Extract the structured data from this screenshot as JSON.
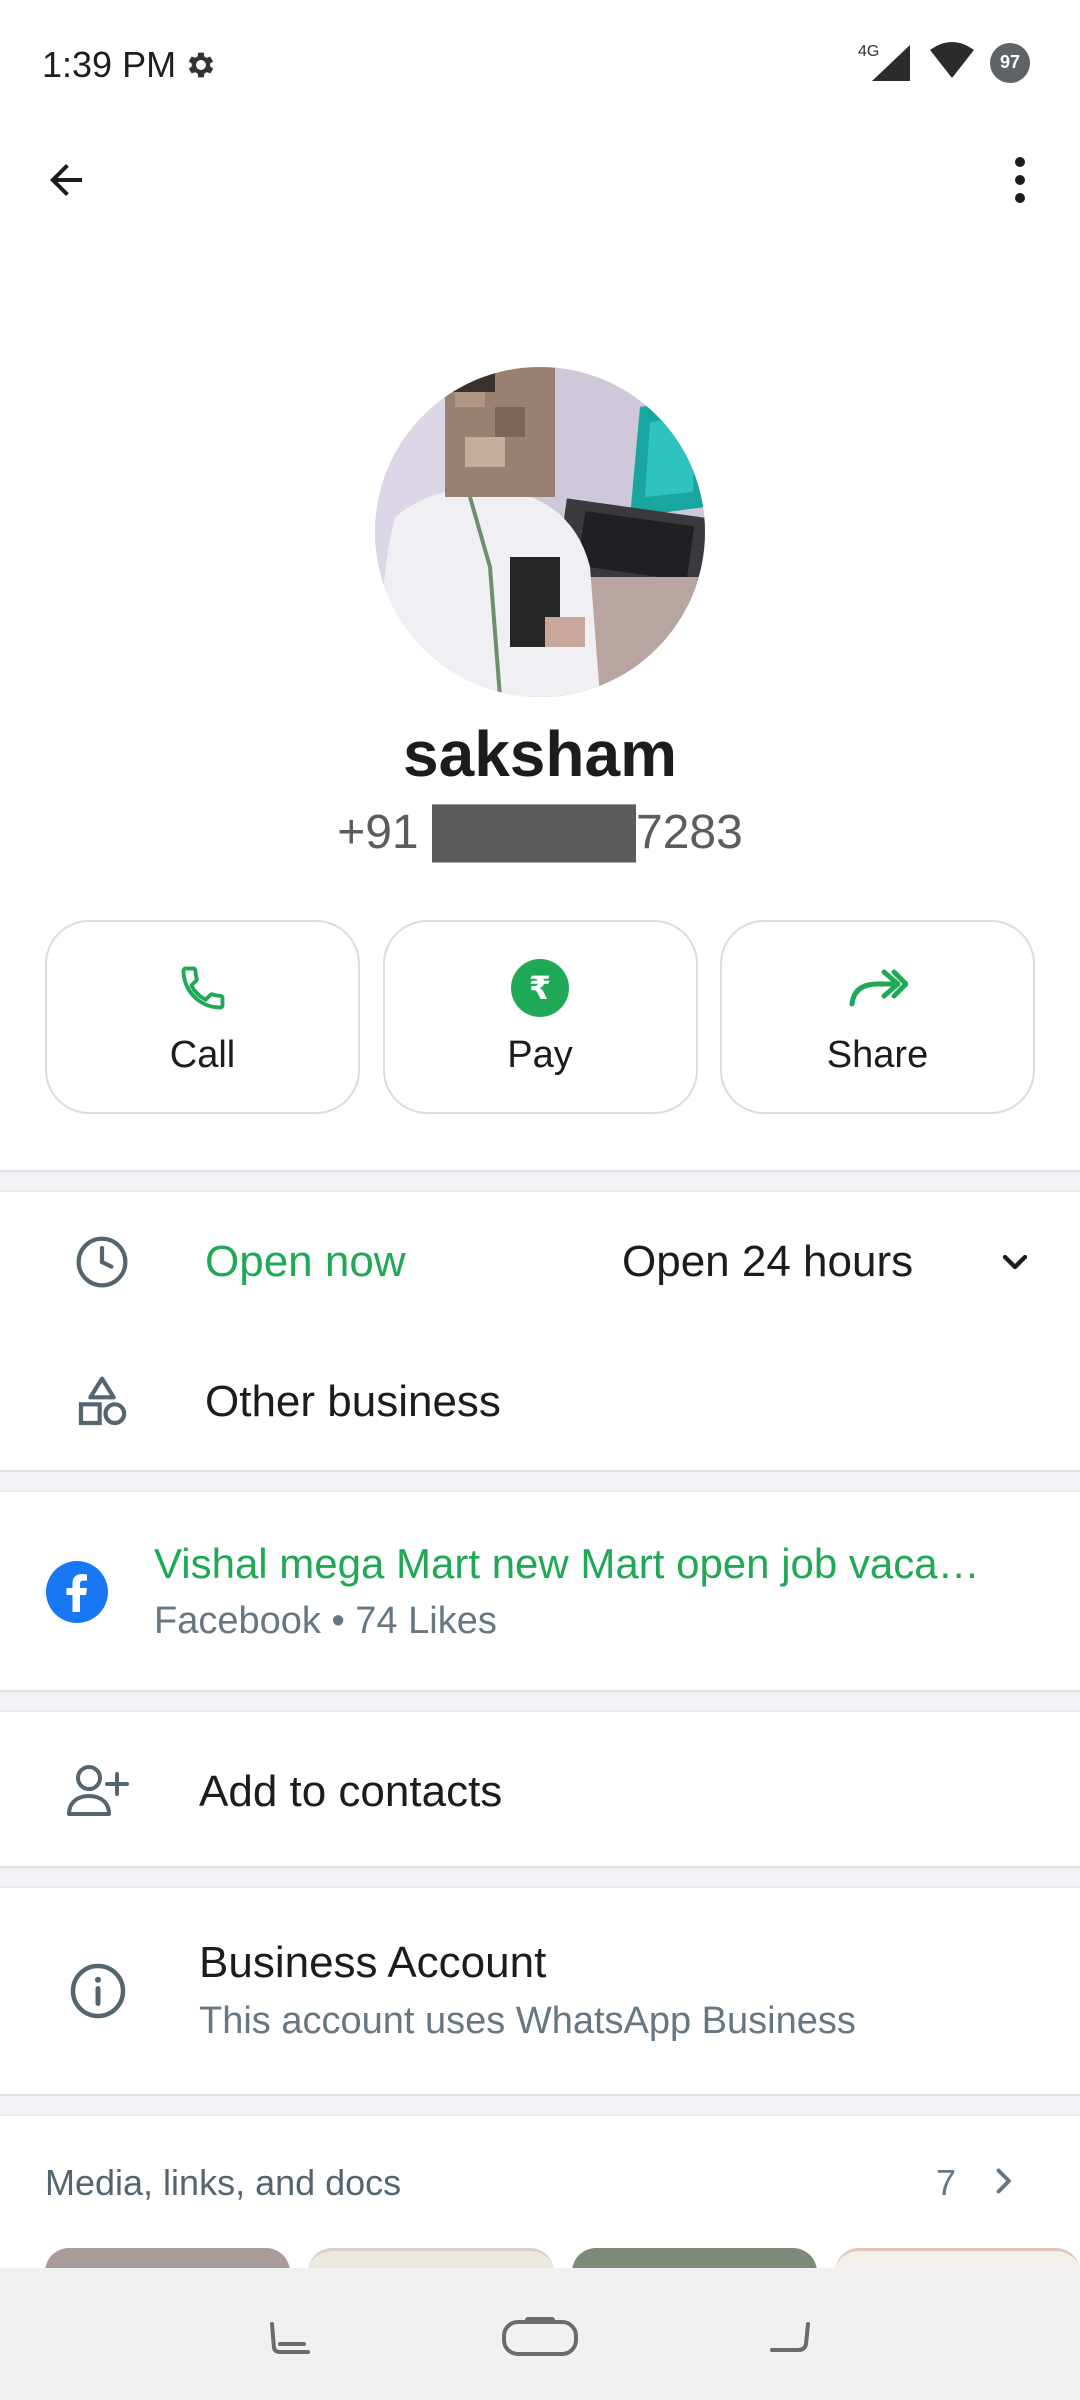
{
  "status_bar": {
    "time": "1:39 PM",
    "network": "4G",
    "battery": "97"
  },
  "profile": {
    "name": "saksham",
    "phone": "+91 ██████7283"
  },
  "actions": [
    {
      "label": "Call",
      "icon": "phone-icon"
    },
    {
      "label": "Pay",
      "icon": "rupee-icon"
    },
    {
      "label": "Share",
      "icon": "share-forward-icon"
    }
  ],
  "hours": {
    "status": "Open now",
    "detail": "Open 24 hours"
  },
  "category": {
    "label": "Other business"
  },
  "facebook": {
    "title": "Vishal mega Mart new Mart open job vaca…",
    "subtitle": "Facebook • 74 Likes"
  },
  "add_contact": {
    "label": "Add to contacts"
  },
  "business": {
    "title": "Business Account",
    "subtitle": "This account uses WhatsApp Business"
  },
  "media": {
    "title": "Media, links, and docs",
    "count": "7"
  },
  "colors": {
    "accent": "#1fa855",
    "facebook": "#1877f2",
    "divider": "#f0f2f5"
  }
}
